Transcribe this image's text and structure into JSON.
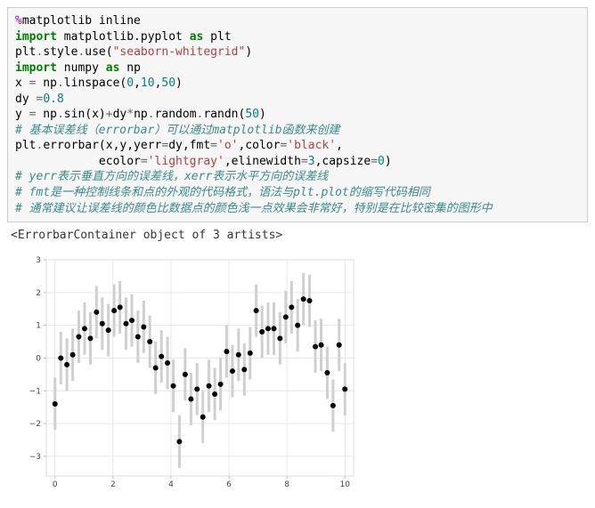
{
  "code": {
    "line1_magic_pct": "%",
    "line1_magic_rest": "matplotlib inline",
    "line2_import": "import",
    "line2_mod": " matplotlib.pyplot ",
    "line2_as": "as",
    "line2_alias": " plt",
    "line3_a": "plt",
    "line3_b": ".",
    "line3_c": "style",
    "line3_d": ".",
    "line3_e": "use(",
    "line3_f": "\"seaborn-whitegrid\"",
    "line3_g": ")",
    "line4_import": "import",
    "line4_mod": " numpy ",
    "line4_as": "as",
    "line4_alias": " np",
    "line5_a": "x ",
    "line5_op": "=",
    "line5_b": " np",
    "line5_c": ".",
    "line5_d": "linspace(",
    "line5_n1": "0",
    "line5_co1": ",",
    "line5_n2": "10",
    "line5_co2": ",",
    "line5_n3": "50",
    "line5_e": ")",
    "line6_a": "dy ",
    "line6_op": "=",
    "line6_n": "0.8",
    "line7_a": "y ",
    "line7_op1": "=",
    "line7_b": " np",
    "line7_c": ".",
    "line7_d": "sin(x)",
    "line7_op2": "+",
    "line7_e": "dy",
    "line7_op3": "*",
    "line7_f": "np",
    "line7_g": ".",
    "line7_h": "random",
    "line7_i": ".",
    "line7_j": "randn(",
    "line7_n": "50",
    "line7_k": ")",
    "cmt1": "# 基本误差线（errorbar）可以通过matplotlib函数来创建",
    "line8_a": "plt",
    "line8_b": ".",
    "line8_c": "errorbar(x,y,yerr",
    "line8_op1": "=",
    "line8_d": "dy,fmt",
    "line8_op2": "=",
    "line8_s1": "'o'",
    "line8_e": ",color",
    "line8_op3": "=",
    "line8_s2": "'black'",
    "line8_f": ",",
    "line9_a": "            ecolor",
    "line9_op1": "=",
    "line9_s1": "'lightgray'",
    "line9_b": ",elinewidth",
    "line9_op2": "=",
    "line9_n1": "3",
    "line9_c": ",capsize",
    "line9_op3": "=",
    "line9_n2": "0",
    "line9_d": ")",
    "cmt2": "# yerr表示垂直方向的误差线，xerr表示水平方向的误差线",
    "cmt3": "# fmt是一种控制线条和点的外观的代码格式，语法与plt.plot的缩写代码相同",
    "cmt4": "# 通常建议让误差线的颜色比数据点的颜色浅一点效果会非常好，特别是在比较密集的图形中"
  },
  "output": {
    "repr": "<ErrorbarContainer object of 3 artists>"
  },
  "chart_data": {
    "type": "scatter",
    "title": "",
    "xlabel": "",
    "ylabel": "",
    "xlim": [
      -0.3,
      10.3
    ],
    "ylim": [
      -3.6,
      3.0
    ],
    "xticks": [
      0,
      2,
      4,
      6,
      8,
      10
    ],
    "yticks": [
      -3,
      -2,
      -1,
      0,
      1,
      2,
      3
    ],
    "dy": 0.8,
    "grid": true,
    "marker": "o",
    "marker_color": "#000000",
    "error_color": "#cfcfcf",
    "error_linewidth": 3,
    "error_capsize": 0,
    "x": [
      0.0,
      0.2,
      0.41,
      0.61,
      0.82,
      1.02,
      1.22,
      1.43,
      1.63,
      1.84,
      2.04,
      2.24,
      2.45,
      2.65,
      2.86,
      3.06,
      3.27,
      3.47,
      3.67,
      3.88,
      4.08,
      4.29,
      4.49,
      4.69,
      4.9,
      5.1,
      5.31,
      5.51,
      5.71,
      5.92,
      6.12,
      6.33,
      6.53,
      6.73,
      6.94,
      7.14,
      7.35,
      7.55,
      7.76,
      7.96,
      8.16,
      8.37,
      8.57,
      8.78,
      8.98,
      9.18,
      9.39,
      9.59,
      9.8,
      10.0
    ],
    "y": [
      -1.4,
      0.0,
      -0.2,
      0.1,
      0.65,
      0.9,
      0.6,
      1.4,
      1.05,
      0.85,
      1.45,
      1.55,
      1.05,
      1.15,
      0.65,
      0.95,
      0.5,
      -0.3,
      0.05,
      -0.15,
      -0.85,
      -2.55,
      -0.5,
      -1.25,
      -0.95,
      -1.8,
      -0.85,
      -1.1,
      -0.8,
      0.2,
      -0.4,
      0.1,
      -0.35,
      0.15,
      1.45,
      0.8,
      0.9,
      0.9,
      0.6,
      1.25,
      1.55,
      1.0,
      1.8,
      1.75,
      0.35,
      0.4,
      -0.45,
      -1.45,
      0.4,
      -0.95
    ]
  }
}
